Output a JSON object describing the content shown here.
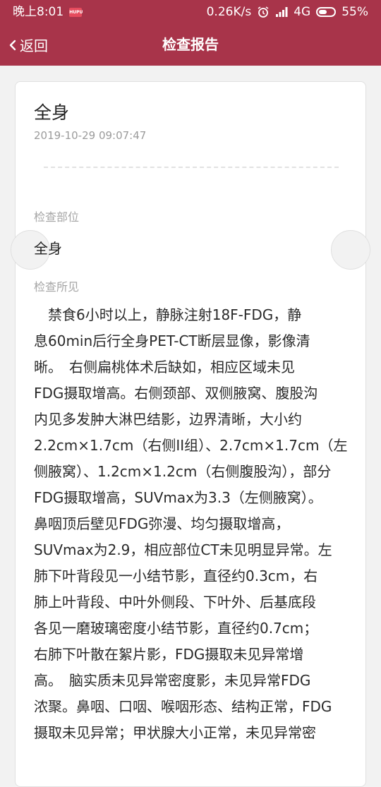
{
  "status_bar": {
    "time": "晚上8:01",
    "speed": "0.26K/s",
    "network": "4G",
    "battery": "55%"
  },
  "nav": {
    "back_label": "返回",
    "title": "检查报告"
  },
  "report": {
    "title": "全身",
    "datetime": "2019-10-29 09:07:47",
    "part_label": "检查部位",
    "part_value": "全身",
    "findings_label": "检查所见",
    "findings_lines": [
      "　禁食6小时以上，静脉注射18F-FDG，静",
      "息60min后行全身PET-CT断层显像，影像清",
      "晰。　右侧扁桃体术后缺如，相应区域未见",
      "FDG摄取增高。右侧颈部、双侧腋窝、腹股沟",
      "内见多发肿大淋巴结影，边界清晰，大小约",
      "2.2cm×1.7cm（右侧II组）、2.7cm×1.7cm（左",
      "侧腋窝）、1.2cm×1.2cm（右侧腹股沟），部分",
      "FDG摄取增高，SUVmax为3.3（左侧腋窝）。",
      "鼻咽顶后壁见FDG弥漫、均匀摄取增高，",
      "SUVmax为2.9，相应部位CT未见明显异常。左",
      "肺下叶背段见一小结节影，直径约0.3cm，右",
      "肺上叶背段、中叶外侧段、下叶外、后基底段",
      "各见一磨玻璃密度小结节影，直径约0.7cm；",
      "右肺下叶散在絮片影，FDG摄取未见异常增",
      "高。　脑实质未见异常密度影，未见异常FDG",
      "浓聚。鼻咽、口咽、喉咽形态、结构正常，FDG",
      "摄取未见异常；甲状腺大小正常，未见异常密"
    ]
  },
  "colors": {
    "accent": "#a8344a",
    "background": "#f2f2f2"
  },
  "icons": [
    "chevron-left-icon",
    "alarm-icon",
    "signal-icon",
    "battery-icon",
    "app-notification-icon"
  ]
}
